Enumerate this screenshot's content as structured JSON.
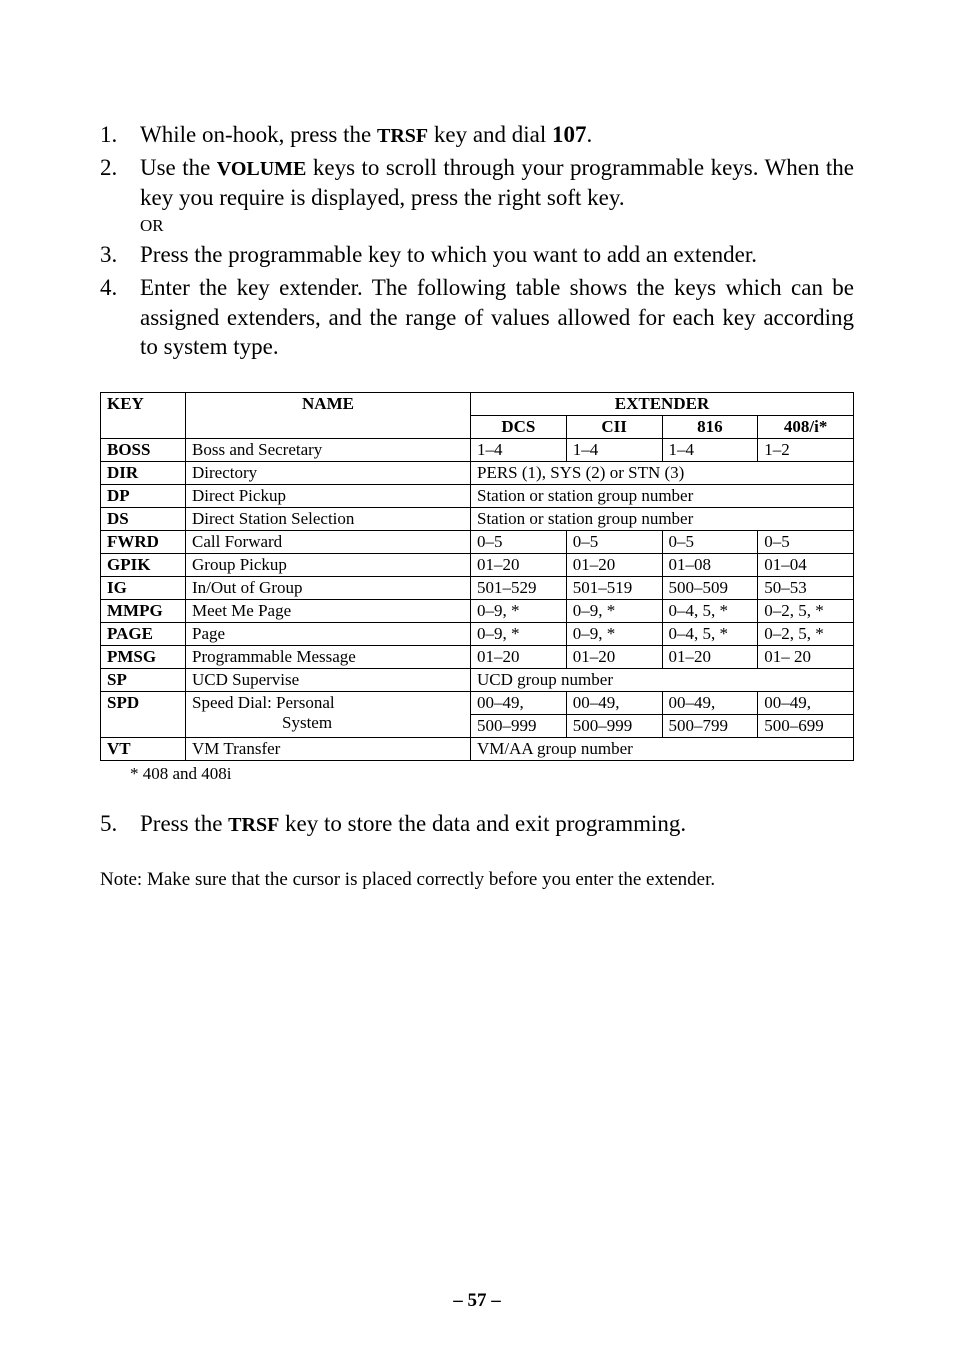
{
  "steps": [
    {
      "num": "1.",
      "html": "While on-hook, press the <span class='smallcaps'>TRSF</span> key and dial <span class='bold'>107</span>."
    },
    {
      "num": "2.",
      "html": "Use the <span class='smallcaps'>VOLUME</span> keys to scroll through your programmable keys. When the key you require is displayed, press the right soft key.<span class='small-or'>OR</span>"
    },
    {
      "num": "3.",
      "html": "Press the programmable key to which you want to add an extender."
    },
    {
      "num": "4.",
      "html": "Enter the key extender. The following table shows the keys which can be assigned extenders, and the range of values allowed for each key according to system type."
    }
  ],
  "table": {
    "headers": {
      "key": "KEY",
      "name": "NAME",
      "extender": "EXTENDER",
      "dcs": "DCS",
      "cii": "CII",
      "c816": "816",
      "c408": "408/i*"
    },
    "rows": [
      {
        "key": "BOSS",
        "name": "Boss and Secretary",
        "cells": [
          "1–4",
          "1–4",
          "1–4",
          "1–2"
        ]
      },
      {
        "key": "DIR",
        "name": "Directory",
        "span": "PERS (1), SYS (2) or STN (3)"
      },
      {
        "key": "DP",
        "name": "Direct Pickup",
        "span": "Station or station group number"
      },
      {
        "key": "DS",
        "name": "Direct Station Selection",
        "span": "Station or station group number"
      },
      {
        "key": "FWRD",
        "name": "Call Forward",
        "cells": [
          "0–5",
          "0–5",
          "0–5",
          "0–5"
        ]
      },
      {
        "key": "GPIK",
        "name": "Group Pickup",
        "cells": [
          "01–20",
          "01–20",
          "01–08",
          "01–04"
        ]
      },
      {
        "key": "IG",
        "name": "In/Out of Group",
        "cells": [
          "501–529",
          "501–519",
          "500–509",
          "50–53"
        ]
      },
      {
        "key": "MMPG",
        "name": "Meet Me Page",
        "cells": [
          "0–9, *",
          "0–9, *",
          "0–4, 5, *",
          "0–2, 5, *"
        ]
      },
      {
        "key": "PAGE",
        "name": "Page",
        "cells": [
          "0–9, *",
          "0–9, *",
          "0–4, 5, *",
          "0–2, 5, *"
        ]
      },
      {
        "key": "PMSG",
        "name": "Programmable Message",
        "cells": [
          "01–20",
          "01–20",
          "01–20",
          "01– 20"
        ]
      },
      {
        "key": "SP",
        "name": "UCD Supervise",
        "span": "UCD group number"
      },
      {
        "key": "SPD",
        "name": "Speed Dial: Personal",
        "cells": [
          "00–49,",
          "00–49,",
          "00–49,",
          "00–49,"
        ],
        "name2": "System",
        "cells2": [
          "500–999",
          "500–999",
          "500–799",
          "500–699"
        ]
      },
      {
        "key": "VT",
        "name": "VM Transfer",
        "span": "VM/AA group number"
      }
    ]
  },
  "footnote": "* 408 and 408i",
  "step5": {
    "num": "5.",
    "html": "Press the <span class='smallcaps'>TRSF</span> key to store the data and exit programming."
  },
  "note": "Note: Make sure that the cursor is placed correctly before you enter the extender.",
  "pagenum": "– 57 –"
}
